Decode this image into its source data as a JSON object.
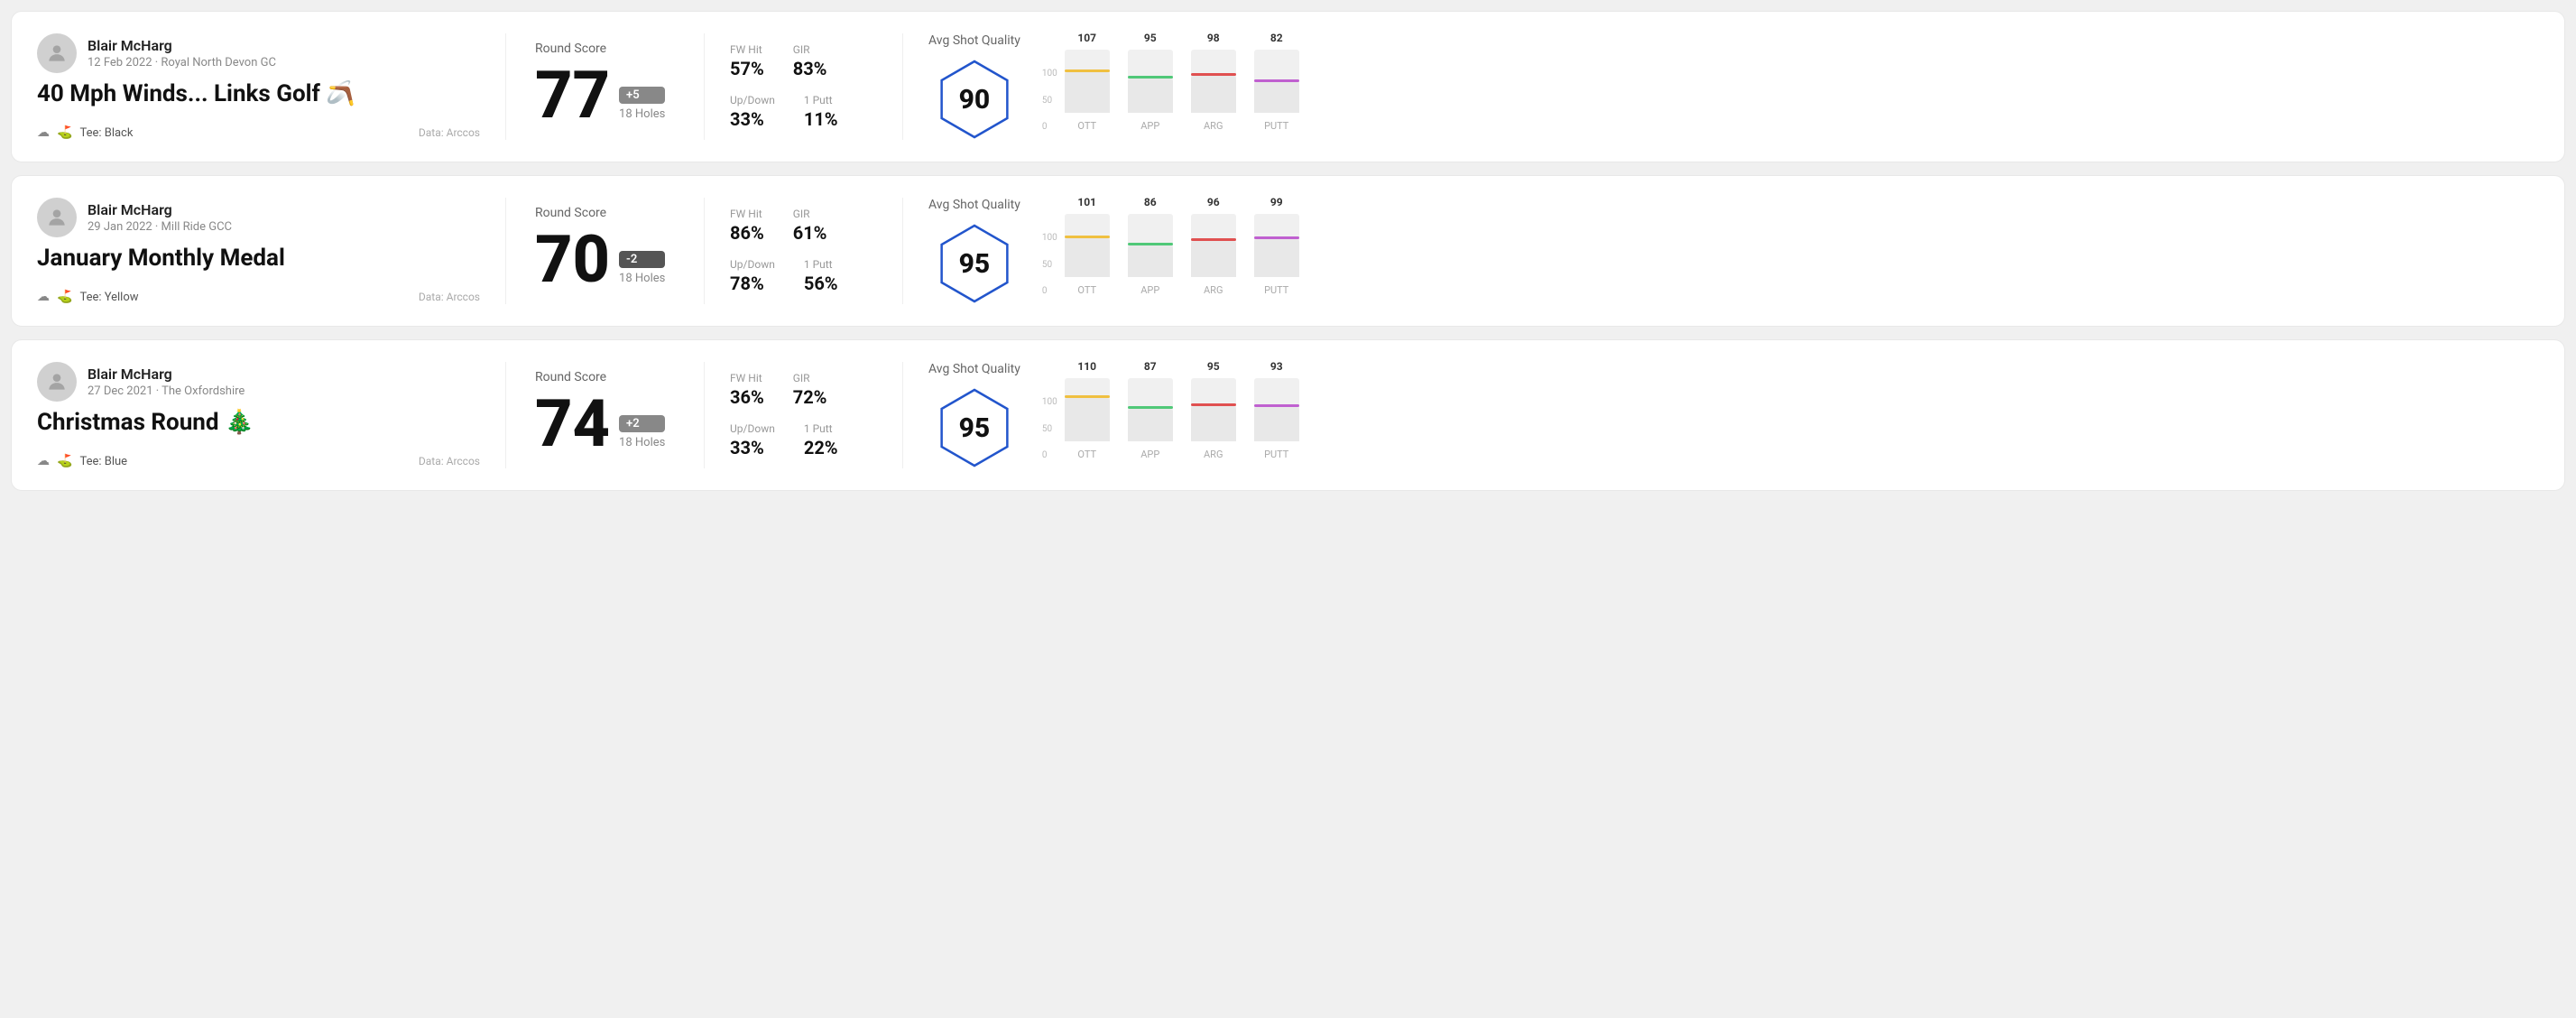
{
  "rounds": [
    {
      "id": "round1",
      "user": {
        "name": "Blair McHarg",
        "date": "12 Feb 2022 · Royal North Devon GC",
        "data_source": "Data: Arccos"
      },
      "title": "40 Mph Winds... Links Golf 🪃",
      "tee": "Tee: Black",
      "score": {
        "label": "Round Score",
        "number": "77",
        "badge": "+5",
        "badge_type": "positive",
        "holes": "18 Holes"
      },
      "stats": {
        "fw_hit_label": "FW Hit",
        "fw_hit_value": "57%",
        "gir_label": "GIR",
        "gir_value": "83%",
        "updown_label": "Up/Down",
        "updown_value": "33%",
        "one_putt_label": "1 Putt",
        "one_putt_value": "11%"
      },
      "quality": {
        "label": "Avg Shot Quality",
        "score": "90",
        "bars": [
          {
            "category": "OTT",
            "value": 107,
            "color": "#f0c040",
            "bar_pct": 65
          },
          {
            "category": "APP",
            "value": 95,
            "color": "#50c878",
            "bar_pct": 55
          },
          {
            "category": "ARG",
            "value": 98,
            "color": "#e05050",
            "bar_pct": 58
          },
          {
            "category": "PUTT",
            "value": 82,
            "color": "#c060d0",
            "bar_pct": 48
          }
        ]
      }
    },
    {
      "id": "round2",
      "user": {
        "name": "Blair McHarg",
        "date": "29 Jan 2022 · Mill Ride GCC",
        "data_source": "Data: Arccos"
      },
      "title": "January Monthly Medal",
      "tee": "Tee: Yellow",
      "score": {
        "label": "Round Score",
        "number": "70",
        "badge": "-2",
        "badge_type": "negative",
        "holes": "18 Holes"
      },
      "stats": {
        "fw_hit_label": "FW Hit",
        "fw_hit_value": "86%",
        "gir_label": "GIR",
        "gir_value": "61%",
        "updown_label": "Up/Down",
        "updown_value": "78%",
        "one_putt_label": "1 Putt",
        "one_putt_value": "56%"
      },
      "quality": {
        "label": "Avg Shot Quality",
        "score": "95",
        "bars": [
          {
            "category": "OTT",
            "value": 101,
            "color": "#f0c040",
            "bar_pct": 62
          },
          {
            "category": "APP",
            "value": 86,
            "color": "#50c878",
            "bar_pct": 50
          },
          {
            "category": "ARG",
            "value": 96,
            "color": "#e05050",
            "bar_pct": 57
          },
          {
            "category": "PUTT",
            "value": 99,
            "color": "#c060d0",
            "bar_pct": 60
          }
        ]
      }
    },
    {
      "id": "round3",
      "user": {
        "name": "Blair McHarg",
        "date": "27 Dec 2021 · The Oxfordshire",
        "data_source": "Data: Arccos"
      },
      "title": "Christmas Round 🎄",
      "tee": "Tee: Blue",
      "score": {
        "label": "Round Score",
        "number": "74",
        "badge": "+2",
        "badge_type": "positive",
        "holes": "18 Holes"
      },
      "stats": {
        "fw_hit_label": "FW Hit",
        "fw_hit_value": "36%",
        "gir_label": "GIR",
        "gir_value": "72%",
        "updown_label": "Up/Down",
        "updown_value": "33%",
        "one_putt_label": "1 Putt",
        "one_putt_value": "22%"
      },
      "quality": {
        "label": "Avg Shot Quality",
        "score": "95",
        "bars": [
          {
            "category": "OTT",
            "value": 110,
            "color": "#f0c040",
            "bar_pct": 68
          },
          {
            "category": "APP",
            "value": 87,
            "color": "#50c878",
            "bar_pct": 51
          },
          {
            "category": "ARG",
            "value": 95,
            "color": "#e05050",
            "bar_pct": 56
          },
          {
            "category": "PUTT",
            "value": 93,
            "color": "#c060d0",
            "bar_pct": 55
          }
        ]
      }
    }
  ],
  "chart": {
    "y_labels": [
      "100",
      "50",
      "0"
    ]
  }
}
